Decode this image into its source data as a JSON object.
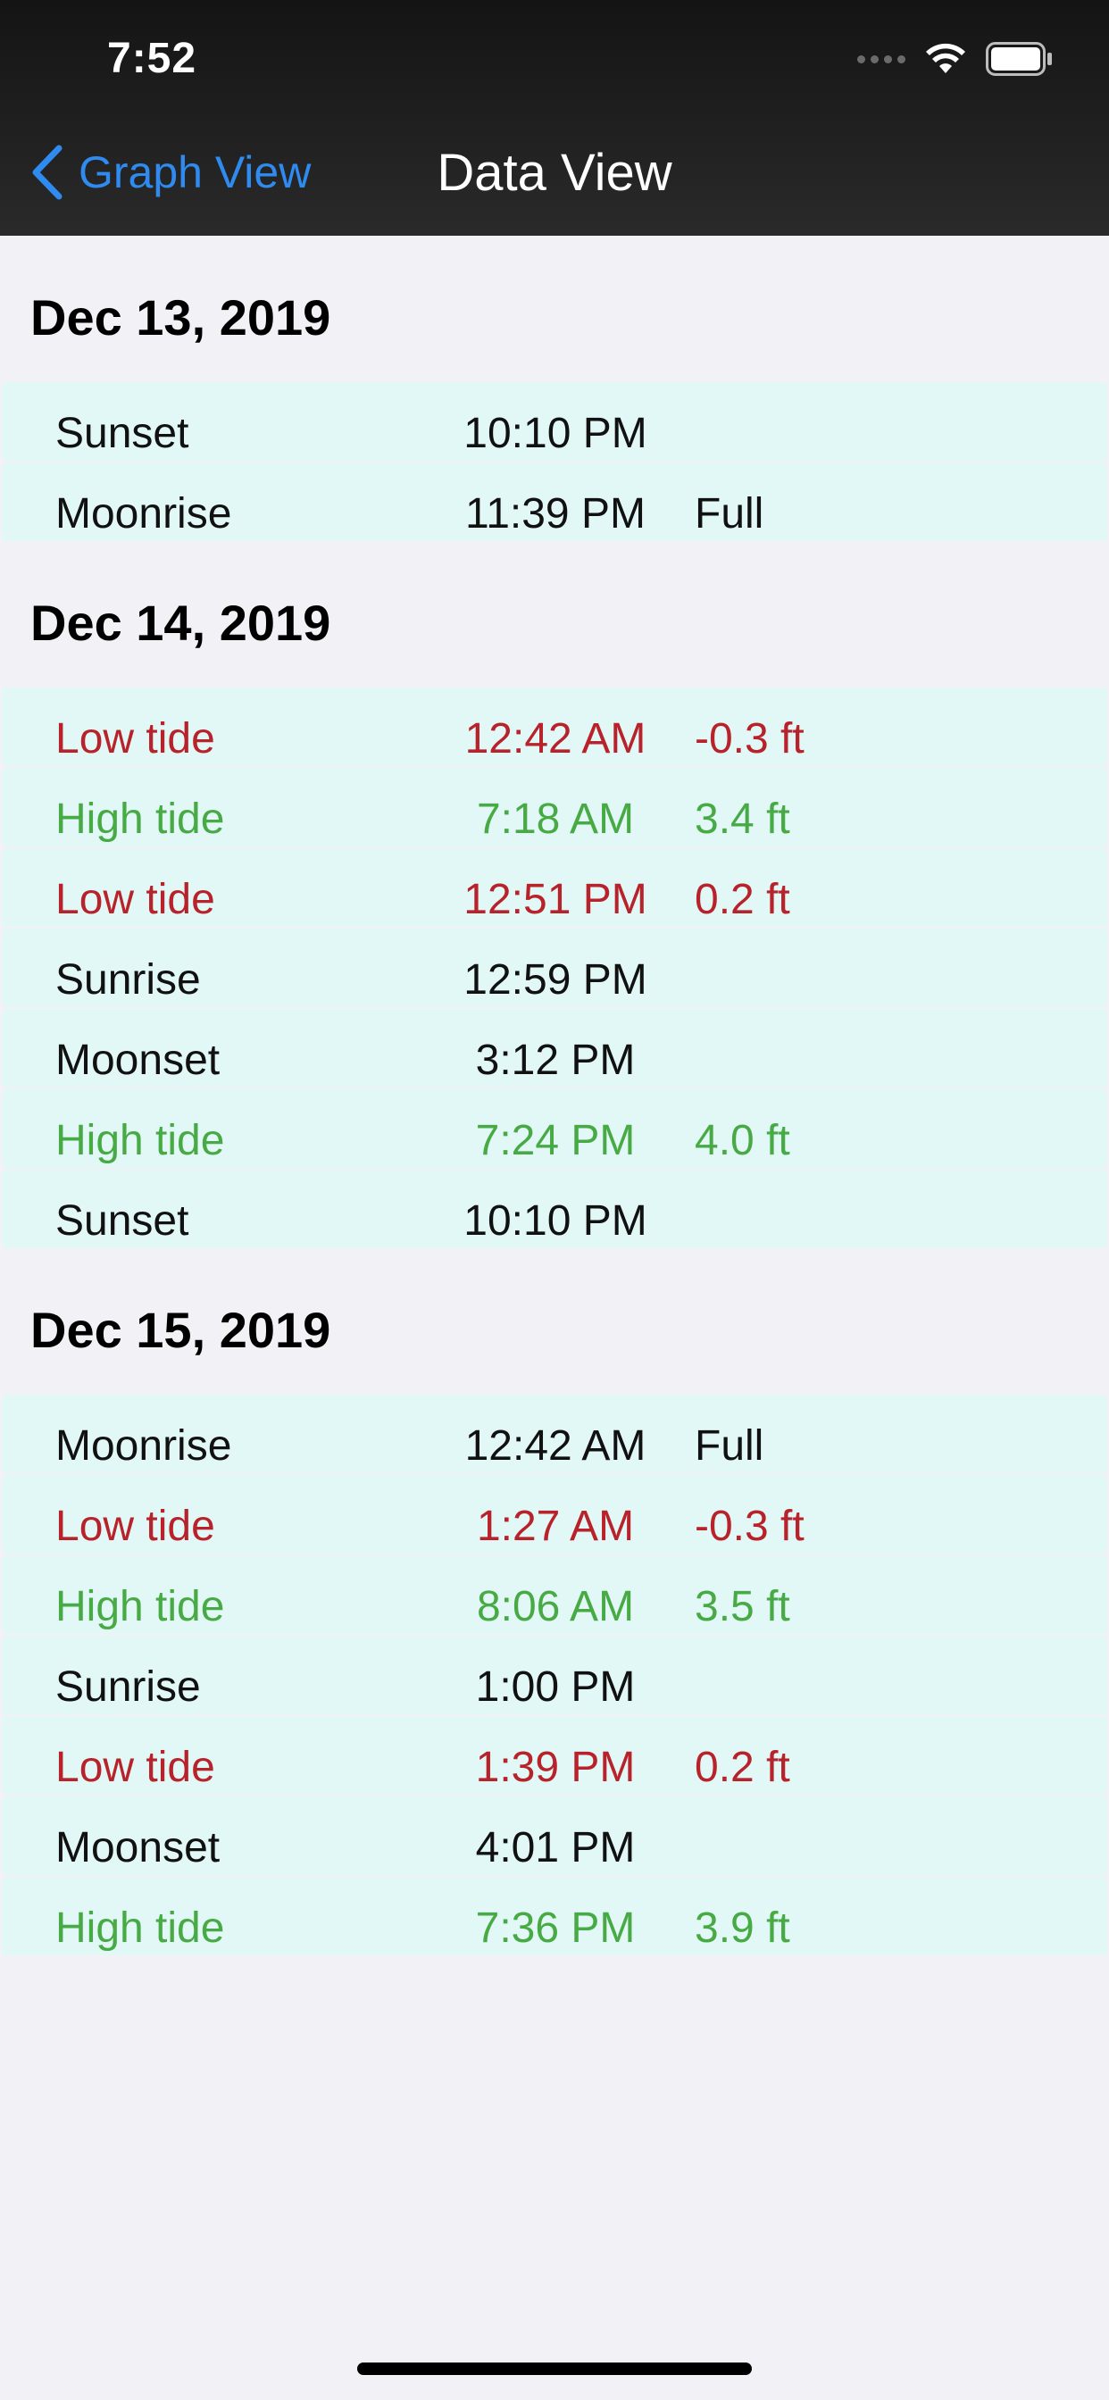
{
  "status": {
    "time": "7:52"
  },
  "nav": {
    "back_label": "Graph View",
    "title": "Data View"
  },
  "sections": [
    {
      "date": "Dec 13, 2019",
      "rows": [
        {
          "event": "Sunset",
          "time": "10:10 PM",
          "extra": "",
          "type": "sun"
        },
        {
          "event": "Moonrise",
          "time": "11:39 PM",
          "extra": "Full",
          "type": "moon"
        }
      ]
    },
    {
      "date": "Dec 14, 2019",
      "rows": [
        {
          "event": "Low tide",
          "time": "12:42 AM",
          "extra": "-0.3 ft",
          "type": "low"
        },
        {
          "event": "High tide",
          "time": "7:18 AM",
          "extra": "3.4 ft",
          "type": "high"
        },
        {
          "event": "Low tide",
          "time": "12:51 PM",
          "extra": "0.2 ft",
          "type": "low"
        },
        {
          "event": "Sunrise",
          "time": "12:59 PM",
          "extra": "",
          "type": "sun"
        },
        {
          "event": "Moonset",
          "time": "3:12 PM",
          "extra": "",
          "type": "moon"
        },
        {
          "event": "High tide",
          "time": "7:24 PM",
          "extra": "4.0 ft",
          "type": "high"
        },
        {
          "event": "Sunset",
          "time": "10:10 PM",
          "extra": "",
          "type": "sun"
        }
      ]
    },
    {
      "date": "Dec 15, 2019",
      "rows": [
        {
          "event": "Moonrise",
          "time": "12:42 AM",
          "extra": "Full",
          "type": "moon"
        },
        {
          "event": "Low tide",
          "time": "1:27 AM",
          "extra": "-0.3 ft",
          "type": "low"
        },
        {
          "event": "High tide",
          "time": "8:06 AM",
          "extra": "3.5 ft",
          "type": "high"
        },
        {
          "event": "Sunrise",
          "time": "1:00 PM",
          "extra": "",
          "type": "sun"
        },
        {
          "event": "Low tide",
          "time": "1:39 PM",
          "extra": "0.2 ft",
          "type": "low"
        },
        {
          "event": "Moonset",
          "time": "4:01 PM",
          "extra": "",
          "type": "moon"
        },
        {
          "event": "High tide",
          "time": "7:36 PM",
          "extra": "3.9 ft",
          "type": "high"
        }
      ]
    }
  ],
  "colors": {
    "low_tide": "#b8222a",
    "high_tide": "#48aa44",
    "default_text": "#111111",
    "row_background": "#e1f8f7",
    "accent": "#2f8bf0"
  },
  "icons": {
    "back": "chevron-left-icon",
    "signal": "signal-dots-icon",
    "wifi": "wifi-icon",
    "battery": "battery-icon"
  }
}
